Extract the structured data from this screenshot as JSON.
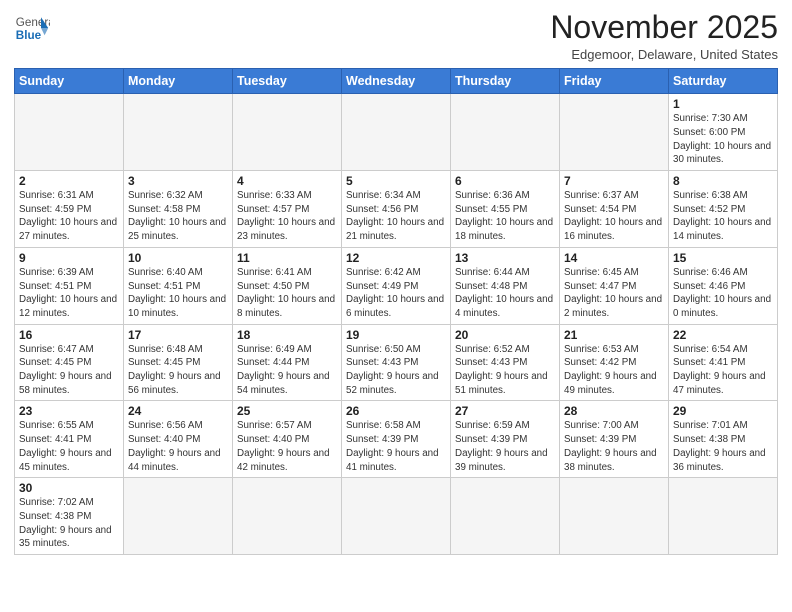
{
  "header": {
    "logo_line1": "General",
    "logo_line2": "Blue",
    "month": "November 2025",
    "location": "Edgemoor, Delaware, United States"
  },
  "weekdays": [
    "Sunday",
    "Monday",
    "Tuesday",
    "Wednesday",
    "Thursday",
    "Friday",
    "Saturday"
  ],
  "weeks": [
    [
      {
        "day": "",
        "info": ""
      },
      {
        "day": "",
        "info": ""
      },
      {
        "day": "",
        "info": ""
      },
      {
        "day": "",
        "info": ""
      },
      {
        "day": "",
        "info": ""
      },
      {
        "day": "",
        "info": ""
      },
      {
        "day": "1",
        "info": "Sunrise: 7:30 AM\nSunset: 6:00 PM\nDaylight: 10 hours and 30 minutes."
      }
    ],
    [
      {
        "day": "2",
        "info": "Sunrise: 6:31 AM\nSunset: 4:59 PM\nDaylight: 10 hours and 27 minutes."
      },
      {
        "day": "3",
        "info": "Sunrise: 6:32 AM\nSunset: 4:58 PM\nDaylight: 10 hours and 25 minutes."
      },
      {
        "day": "4",
        "info": "Sunrise: 6:33 AM\nSunset: 4:57 PM\nDaylight: 10 hours and 23 minutes."
      },
      {
        "day": "5",
        "info": "Sunrise: 6:34 AM\nSunset: 4:56 PM\nDaylight: 10 hours and 21 minutes."
      },
      {
        "day": "6",
        "info": "Sunrise: 6:36 AM\nSunset: 4:55 PM\nDaylight: 10 hours and 18 minutes."
      },
      {
        "day": "7",
        "info": "Sunrise: 6:37 AM\nSunset: 4:54 PM\nDaylight: 10 hours and 16 minutes."
      },
      {
        "day": "8",
        "info": "Sunrise: 6:38 AM\nSunset: 4:52 PM\nDaylight: 10 hours and 14 minutes."
      }
    ],
    [
      {
        "day": "9",
        "info": "Sunrise: 6:39 AM\nSunset: 4:51 PM\nDaylight: 10 hours and 12 minutes."
      },
      {
        "day": "10",
        "info": "Sunrise: 6:40 AM\nSunset: 4:51 PM\nDaylight: 10 hours and 10 minutes."
      },
      {
        "day": "11",
        "info": "Sunrise: 6:41 AM\nSunset: 4:50 PM\nDaylight: 10 hours and 8 minutes."
      },
      {
        "day": "12",
        "info": "Sunrise: 6:42 AM\nSunset: 4:49 PM\nDaylight: 10 hours and 6 minutes."
      },
      {
        "day": "13",
        "info": "Sunrise: 6:44 AM\nSunset: 4:48 PM\nDaylight: 10 hours and 4 minutes."
      },
      {
        "day": "14",
        "info": "Sunrise: 6:45 AM\nSunset: 4:47 PM\nDaylight: 10 hours and 2 minutes."
      },
      {
        "day": "15",
        "info": "Sunrise: 6:46 AM\nSunset: 4:46 PM\nDaylight: 10 hours and 0 minutes."
      }
    ],
    [
      {
        "day": "16",
        "info": "Sunrise: 6:47 AM\nSunset: 4:45 PM\nDaylight: 9 hours and 58 minutes."
      },
      {
        "day": "17",
        "info": "Sunrise: 6:48 AM\nSunset: 4:45 PM\nDaylight: 9 hours and 56 minutes."
      },
      {
        "day": "18",
        "info": "Sunrise: 6:49 AM\nSunset: 4:44 PM\nDaylight: 9 hours and 54 minutes."
      },
      {
        "day": "19",
        "info": "Sunrise: 6:50 AM\nSunset: 4:43 PM\nDaylight: 9 hours and 52 minutes."
      },
      {
        "day": "20",
        "info": "Sunrise: 6:52 AM\nSunset: 4:43 PM\nDaylight: 9 hours and 51 minutes."
      },
      {
        "day": "21",
        "info": "Sunrise: 6:53 AM\nSunset: 4:42 PM\nDaylight: 9 hours and 49 minutes."
      },
      {
        "day": "22",
        "info": "Sunrise: 6:54 AM\nSunset: 4:41 PM\nDaylight: 9 hours and 47 minutes."
      }
    ],
    [
      {
        "day": "23",
        "info": "Sunrise: 6:55 AM\nSunset: 4:41 PM\nDaylight: 9 hours and 45 minutes."
      },
      {
        "day": "24",
        "info": "Sunrise: 6:56 AM\nSunset: 4:40 PM\nDaylight: 9 hours and 44 minutes."
      },
      {
        "day": "25",
        "info": "Sunrise: 6:57 AM\nSunset: 4:40 PM\nDaylight: 9 hours and 42 minutes."
      },
      {
        "day": "26",
        "info": "Sunrise: 6:58 AM\nSunset: 4:39 PM\nDaylight: 9 hours and 41 minutes."
      },
      {
        "day": "27",
        "info": "Sunrise: 6:59 AM\nSunset: 4:39 PM\nDaylight: 9 hours and 39 minutes."
      },
      {
        "day": "28",
        "info": "Sunrise: 7:00 AM\nSunset: 4:39 PM\nDaylight: 9 hours and 38 minutes."
      },
      {
        "day": "29",
        "info": "Sunrise: 7:01 AM\nSunset: 4:38 PM\nDaylight: 9 hours and 36 minutes."
      }
    ],
    [
      {
        "day": "30",
        "info": "Sunrise: 7:02 AM\nSunset: 4:38 PM\nDaylight: 9 hours and 35 minutes."
      },
      {
        "day": "",
        "info": ""
      },
      {
        "day": "",
        "info": ""
      },
      {
        "day": "",
        "info": ""
      },
      {
        "day": "",
        "info": ""
      },
      {
        "day": "",
        "info": ""
      },
      {
        "day": "",
        "info": ""
      }
    ]
  ]
}
